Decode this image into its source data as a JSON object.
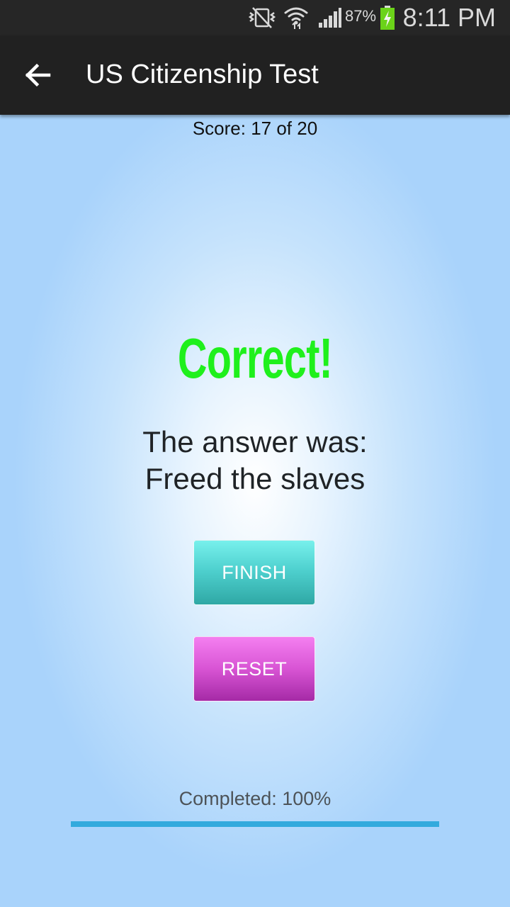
{
  "status_bar": {
    "battery_percent": "87%",
    "time": "8:11 PM",
    "icons": [
      "mute-vibrate-icon",
      "wifi-icon",
      "signal-icon",
      "battery-charging-icon"
    ]
  },
  "app_bar": {
    "back_icon": "arrow-left-icon",
    "title": "US Citizenship Test"
  },
  "quiz": {
    "score": "Score: 17 of 20",
    "result": "Correct!",
    "answer_label": "The answer was:",
    "answer_value": "Freed the slaves",
    "finish_label": "FINISH",
    "reset_label": "RESET",
    "completed_label": "Completed: 100%",
    "progress": 1.0
  },
  "colors": {
    "result": "#1ff01c",
    "finish_button": "#4fd1cf",
    "reset_button": "#d854d4",
    "progress": "#33aadd",
    "app_bar": "#212121"
  }
}
